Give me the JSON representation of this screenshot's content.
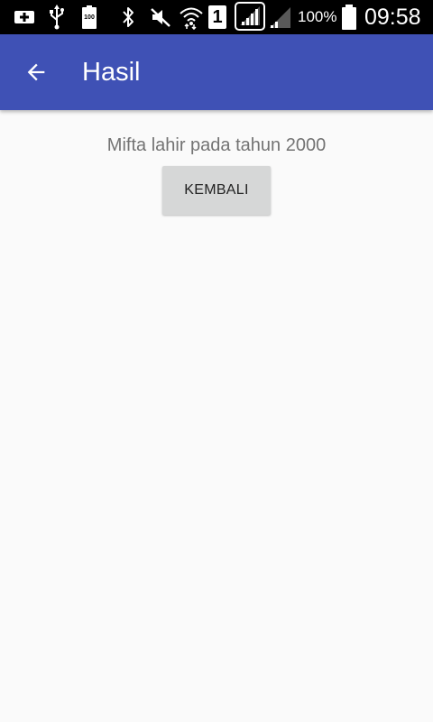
{
  "status_bar": {
    "icons": [
      "add-box-icon",
      "usb-icon",
      "battery-100-icon",
      "bluetooth-icon",
      "muted-icon",
      "wifi-icon",
      "sim-1-icon",
      "signal-icon",
      "signal-2-icon"
    ],
    "sim_label": "1",
    "battery_small_label": "100",
    "battery_percent": "100%",
    "time": "09:58"
  },
  "app_bar": {
    "title": "Hasil",
    "color": "#3f51b5",
    "back_icon": "arrow-back-icon"
  },
  "content": {
    "result_text": "Mifta lahir pada tahun 2000",
    "back_button_label": "KEMBALI"
  }
}
